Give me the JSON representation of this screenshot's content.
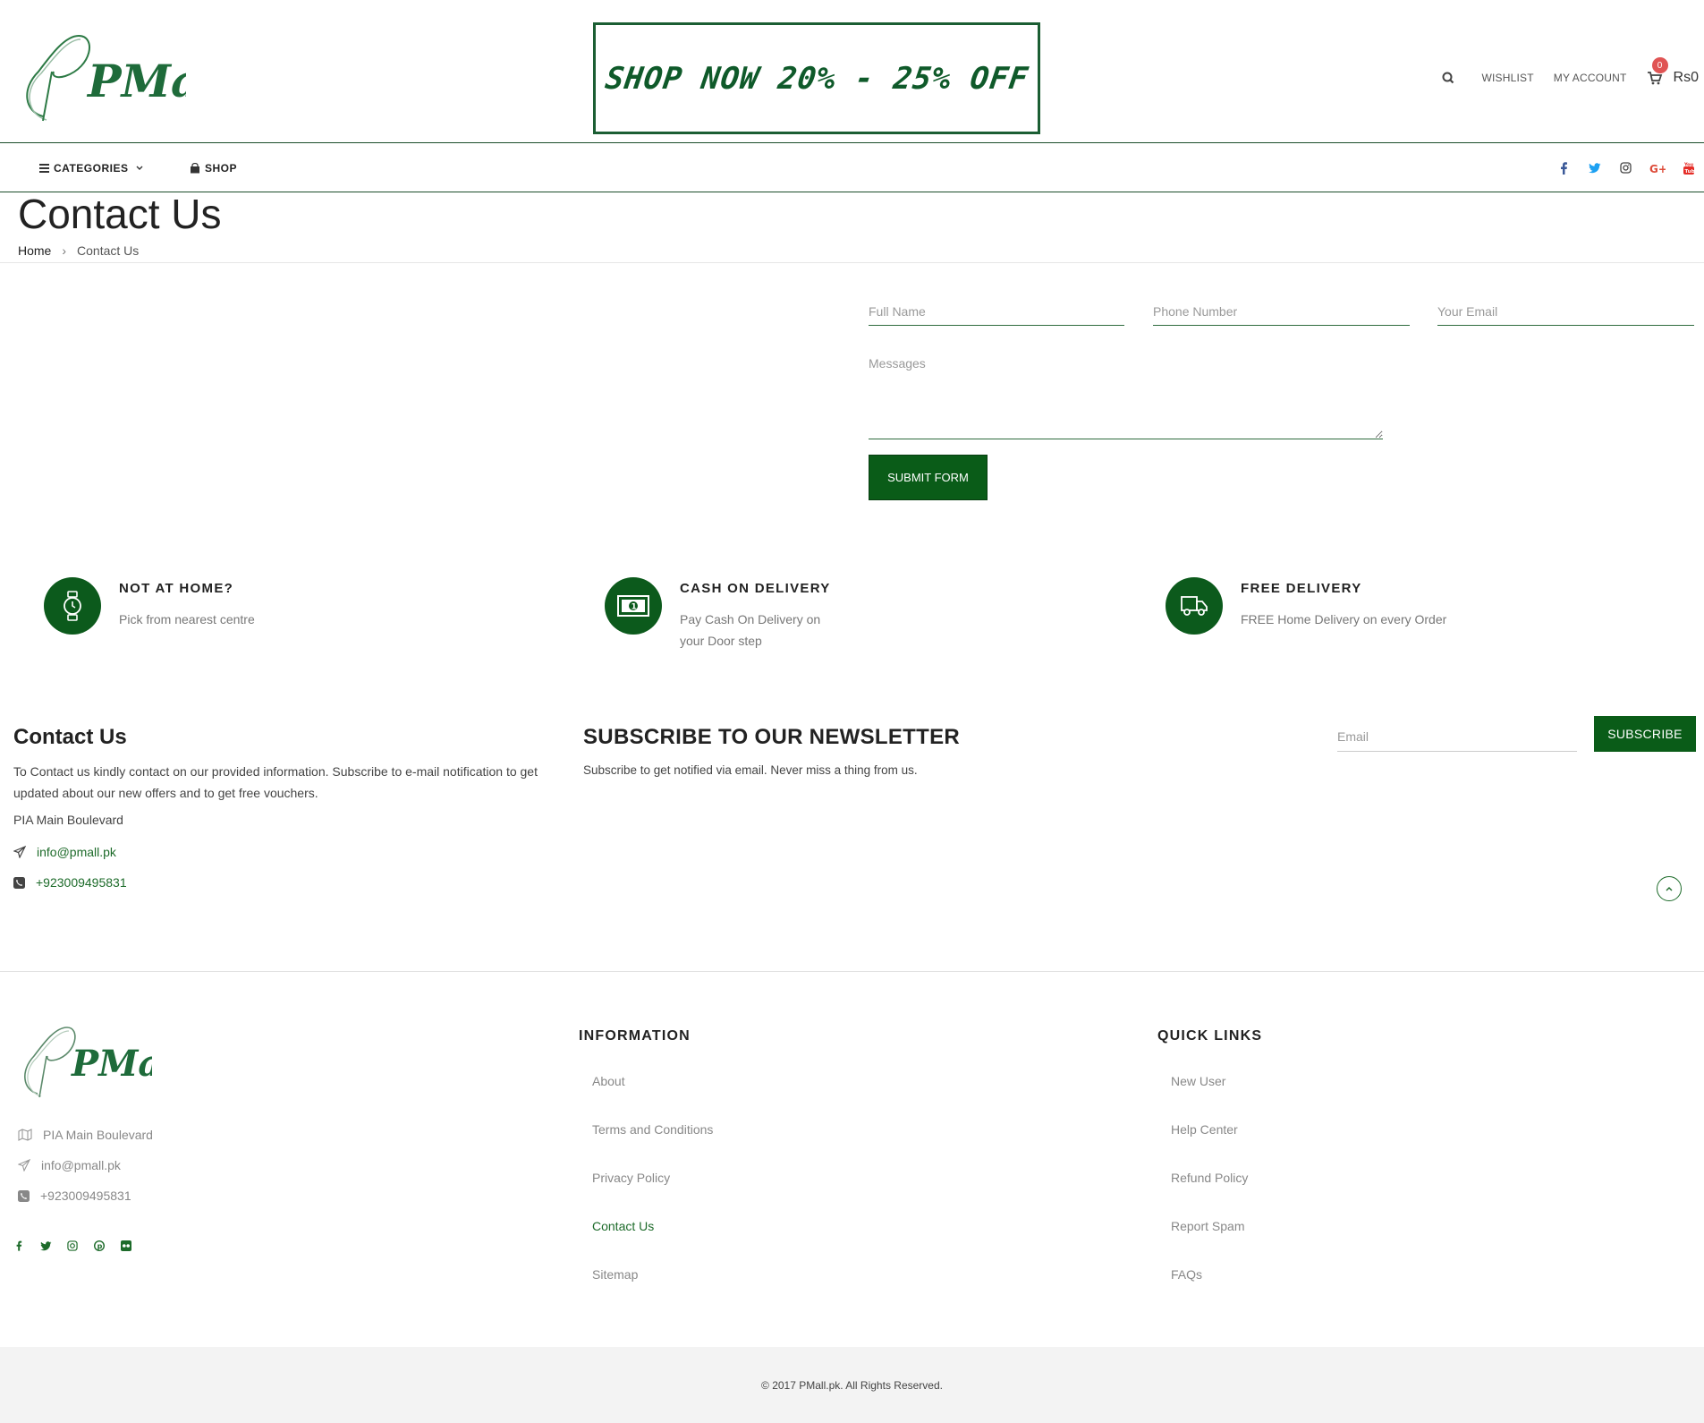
{
  "header": {
    "brand": "PMall",
    "promo_text": "SHOP NOW 20% - 25% OFF",
    "wishlist": "WISHLIST",
    "account": "MY ACCOUNT",
    "cart_count": "0",
    "cart_total": "Rs0"
  },
  "nav": {
    "categories": "CATEGORIES",
    "shop": "SHOP",
    "social_icons": [
      "facebook-icon",
      "twitter-icon",
      "instagram-icon",
      "google-plus-icon",
      "youtube-icon"
    ]
  },
  "page": {
    "title": "Contact Us",
    "breadcrumb_home": "Home",
    "breadcrumb_current": "Contact Us"
  },
  "form": {
    "full_name_placeholder": "Full Name",
    "phone_placeholder": "Phone Number",
    "email_placeholder": "Your Email",
    "message_placeholder": "Messages",
    "submit_label": "SUBMIT FORM"
  },
  "features": [
    {
      "title": "NOT AT HOME?",
      "desc": "Pick from nearest centre",
      "icon": "watch-icon"
    },
    {
      "title": "CASH ON DELIVERY",
      "desc": "Pay Cash On Delivery on your Door step",
      "icon": "cash-icon"
    },
    {
      "title": "FREE DELIVERY",
      "desc": "FREE Home Delivery on every Order",
      "icon": "truck-icon"
    }
  ],
  "contact": {
    "title": "Contact Us",
    "text": "To Contact us kindly contact on our provided information. Subscribe to e-mail notification to get updated about our new offers and to get free vouchers.",
    "address": "PIA Main Boulevard",
    "email": "info@pmall.pk",
    "phone": "+923009495831"
  },
  "newsletter": {
    "title": "SUBSCRIBE TO OUR NEWSLETTER",
    "text": "Subscribe to get notified via email. Never miss a thing from us.",
    "email_placeholder": "Email",
    "button": "SUBSCRIBE"
  },
  "footer": {
    "address": "PIA Main Boulevard",
    "email": "info@pmall.pk",
    "phone": "+923009495831",
    "social_icons": [
      "facebook-icon",
      "twitter-icon",
      "instagram-icon",
      "pinterest-icon",
      "flickr-icon"
    ],
    "information_title": "INFORMATION",
    "information_links": [
      "About",
      "Terms and Conditions",
      "Privacy Policy",
      "Contact Us",
      "Sitemap"
    ],
    "quick_links_title": "QUICK LINKS",
    "quick_links": [
      "New User",
      "Help Center",
      "Refund Policy",
      "Report Spam",
      "FAQs"
    ],
    "copyright": "© 2017 PMall.pk. All Rights Reserved."
  },
  "colors": {
    "brand_green": "#0a5c18",
    "badge_red": "#e05454",
    "footer_bg": "#f3f3f3"
  }
}
